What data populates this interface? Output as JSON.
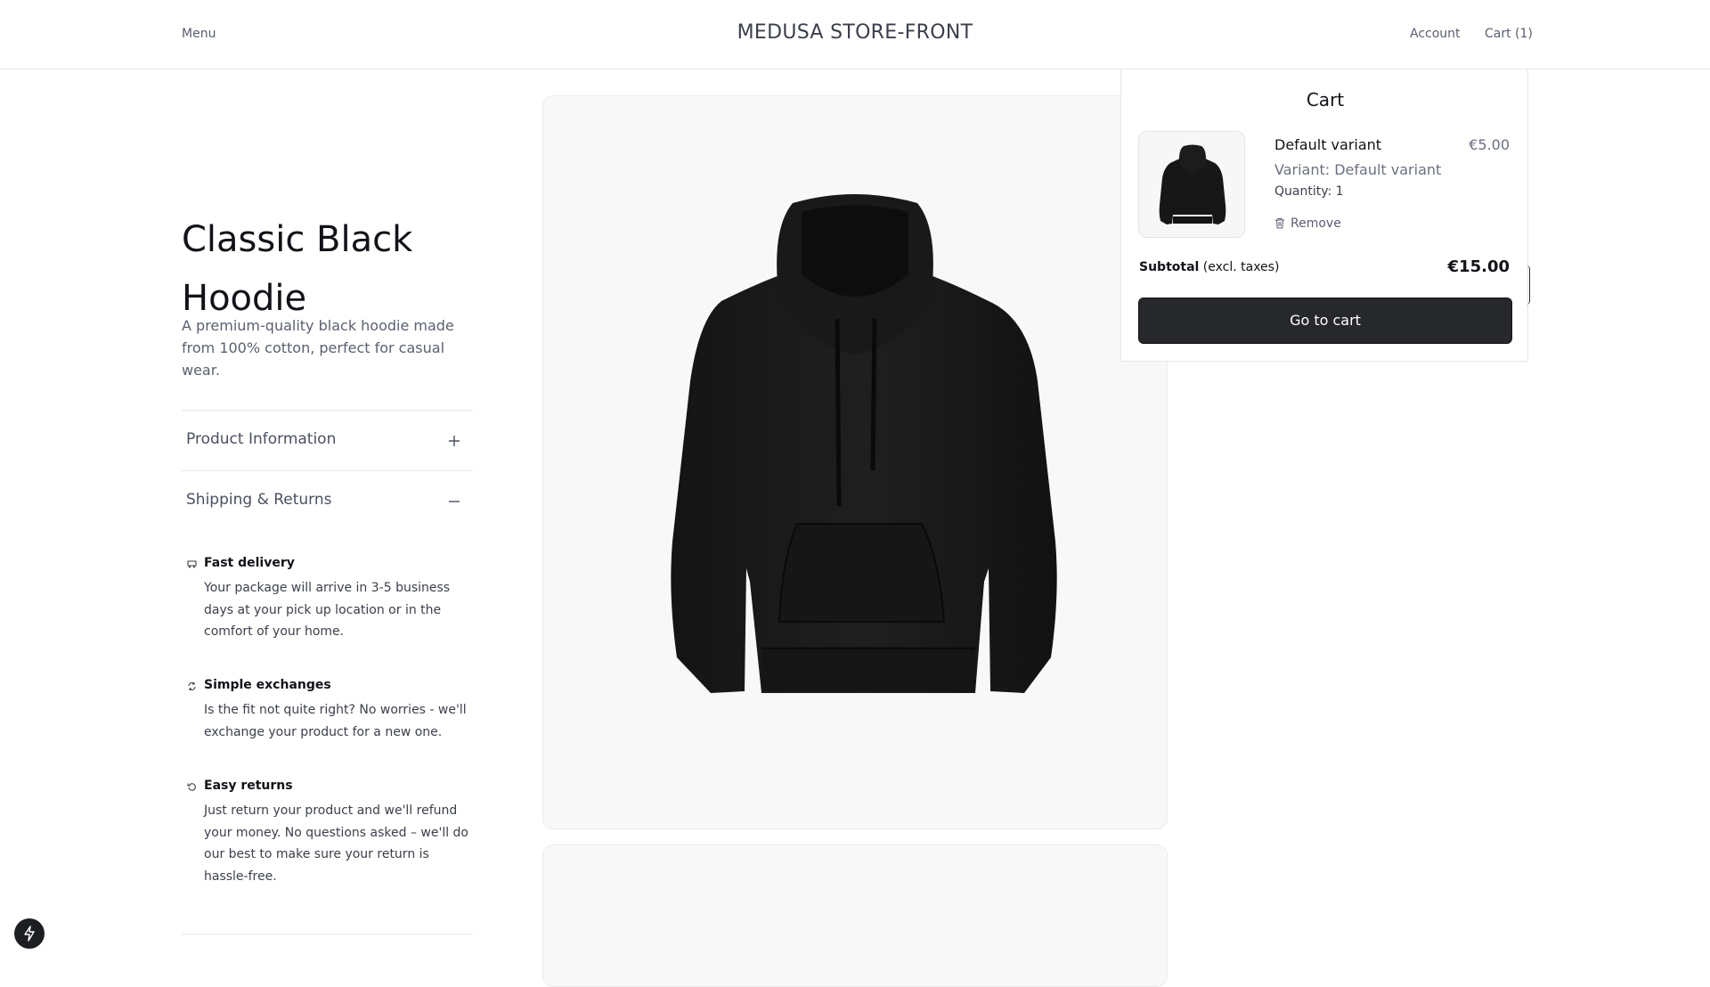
{
  "header": {
    "menu_label": "Menu",
    "brand": "MEDUSA STORE-FRONT",
    "account_label": "Account",
    "cart_label": "Cart (1)"
  },
  "product": {
    "title": "Classic Black Hoodie",
    "description": "A premium-quality black hoodie made from 100% cotton, perfect for casual wear."
  },
  "accordion": [
    {
      "label": "Product Information",
      "state": "collapsed"
    },
    {
      "label": "Shipping & Returns",
      "state": "expanded"
    }
  ],
  "shipping": [
    {
      "icon": "delivery-icon",
      "title": "Fast delivery",
      "body": "Your package will arrive in 3-5 business days at your pick up location or in the comfort of your home."
    },
    {
      "icon": "exchange-icon",
      "title": "Simple exchanges",
      "body": "Is the fit not quite right? No worries - we'll exchange your product for a new one."
    },
    {
      "icon": "return-icon",
      "title": "Easy returns",
      "body": "Just return your product and we'll refund your money. No questions asked – we'll do our best to make sure your return is hassle-free."
    }
  ],
  "cart": {
    "title": "Cart",
    "item": {
      "name": "Default variant",
      "price": "€5.00",
      "variant": "Variant: Default variant",
      "quantity": "Quantity: 1",
      "remove_label": "Remove"
    },
    "subtotal_label": "Subtotal",
    "subtotal_note": "(excl. taxes)",
    "subtotal_value": "€15.00",
    "cta_label": "Go to cart"
  },
  "colors": {
    "cta_bg": "#27282c",
    "muted_text": "#6b7080",
    "gallery_bg": "#f8f8f8"
  }
}
